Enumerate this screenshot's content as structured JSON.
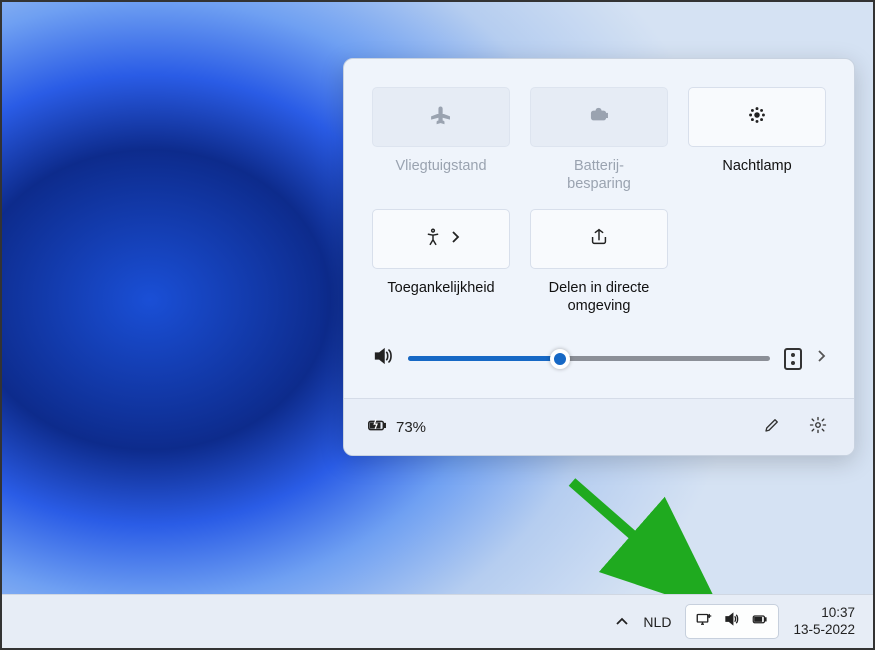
{
  "quick_settings": {
    "tiles": [
      {
        "id": "airplane",
        "label": "Vliegtuigstand",
        "state": "disabled",
        "icon": "airplane-icon"
      },
      {
        "id": "battery_saver",
        "label": "Batterij-\nbesparing",
        "state": "disabled",
        "icon": "battery-saver-icon"
      },
      {
        "id": "night_light",
        "label": "Nachtlamp",
        "state": "enabled",
        "icon": "night-light-icon"
      },
      {
        "id": "accessibility",
        "label": "Toegankelijkheid",
        "state": "enabled",
        "icon": "accessibility-icon",
        "has_chevron": true
      },
      {
        "id": "nearby_share",
        "label": "Delen in directe\nomgeving",
        "state": "enabled",
        "icon": "share-icon"
      }
    ],
    "volume": {
      "value": 42,
      "min": 0,
      "max": 100
    },
    "battery": {
      "percent_label": "73%"
    }
  },
  "taskbar": {
    "language": "NLD",
    "time": "10:37",
    "date": "13-5-2022"
  }
}
